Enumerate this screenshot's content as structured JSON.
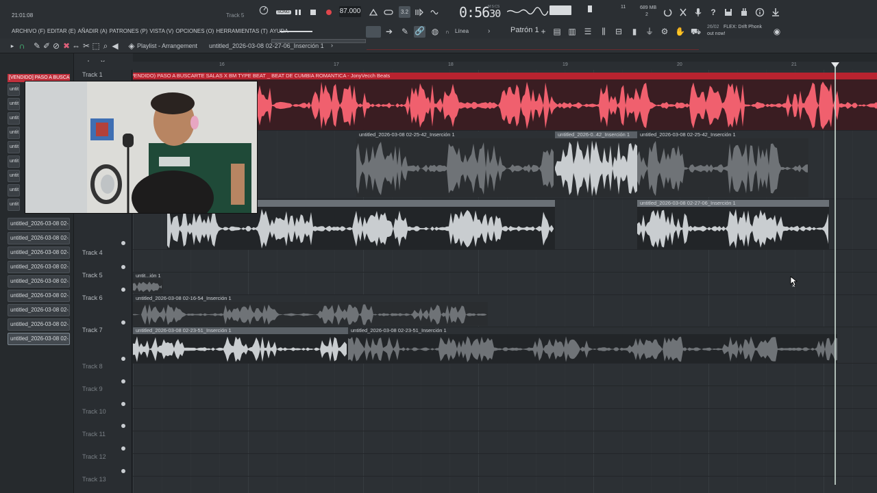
{
  "window": {
    "time": "21:01:08",
    "hint_track": "Track 5",
    "song_mode": "SONG",
    "tempo": "87.000",
    "clock_main": "0:56",
    "clock_sub": "30",
    "clock_unit": "M:S:CS",
    "cpu": "11",
    "memory": "689 MB",
    "voices": "2",
    "news_date": "26/02",
    "news_line1": "FLEX: Drift Phonk",
    "news_line2": "out now!",
    "snap_mode": "Línea",
    "pattern": "Patrón 1"
  },
  "menu": [
    "ARCHIVO (F)",
    "EDITAR (E)",
    "AÑADIR (A)",
    "PATRONES (P)",
    "VISTA (V)",
    "OPCIONES (O)",
    "HERRAMIENTAS (T)",
    "AYUDA"
  ],
  "playlist": {
    "title": "Playlist - Arrangement",
    "breadcrumb": "untitled_2026-03-08 02-27-06_Inserción 1",
    "bars": [
      "16",
      "17",
      "18",
      "19",
      "20",
      "21"
    ]
  },
  "browser": {
    "top_label": "[VENDIDO] PASO A BUSCA...",
    "mini_labels": [
      "untit",
      "untit",
      "untit",
      "untit",
      "untit",
      "untit",
      "untit",
      "untit",
      "untit"
    ],
    "items": [
      "untitled_2026-03-08 02-...",
      "untitled_2026-03-08 02-...",
      "untitled_2026-03-08 02-...",
      "untitled_2026-03-08 02-...",
      "untitled_2026-03-08 02-...",
      "untitled_2026-03-08 02-...",
      "untitled_2026-03-08 02-...",
      "untitled_2026-03-08 02-...",
      "untitled_2026-03-08 02-..."
    ]
  },
  "tracks": [
    {
      "label": "Track 1"
    },
    {
      "label": "Track 4"
    },
    {
      "label": "Track 5"
    },
    {
      "label": "Track 6"
    },
    {
      "label": "Track 7"
    },
    {
      "label": "Track 8"
    },
    {
      "label": "Track 9"
    },
    {
      "label": "Track 10"
    },
    {
      "label": "Track 11"
    },
    {
      "label": "Track 12"
    },
    {
      "label": "Track 13"
    }
  ],
  "clips": {
    "beat": "(VENDIDO) PASO A BUSCARTE SALAS X BM TYPE BEAT _ BEAT DE CUMBIA ROMANTICA - JonyVecch Beats",
    "t2a": "untitled_2026-03-08 02-25-42_Inserción 1",
    "t2b": "untitled_2026-0..42_Inserción 1",
    "t2c": "untitled_2026-03-08 02-25-42_Inserción 1",
    "t3a": "nserción 1",
    "t3b": "untitled_2026-03-08 02-27-06_Inserción 1",
    "t5": "untit...ión 1",
    "t6": "untitled_2026-03-08 02-16-54_Inserción 1",
    "t7a": "untitled_2026-03-08 02-23-51_Inserción 1",
    "t7b": "untitled_2026-03-08 02-23-51_Inserción 1"
  },
  "colors": {
    "beat_clip": "#f0606e",
    "audio_active": "#c9cdd0",
    "audio_muted": "#6f7377",
    "background": "#2c3034"
  }
}
